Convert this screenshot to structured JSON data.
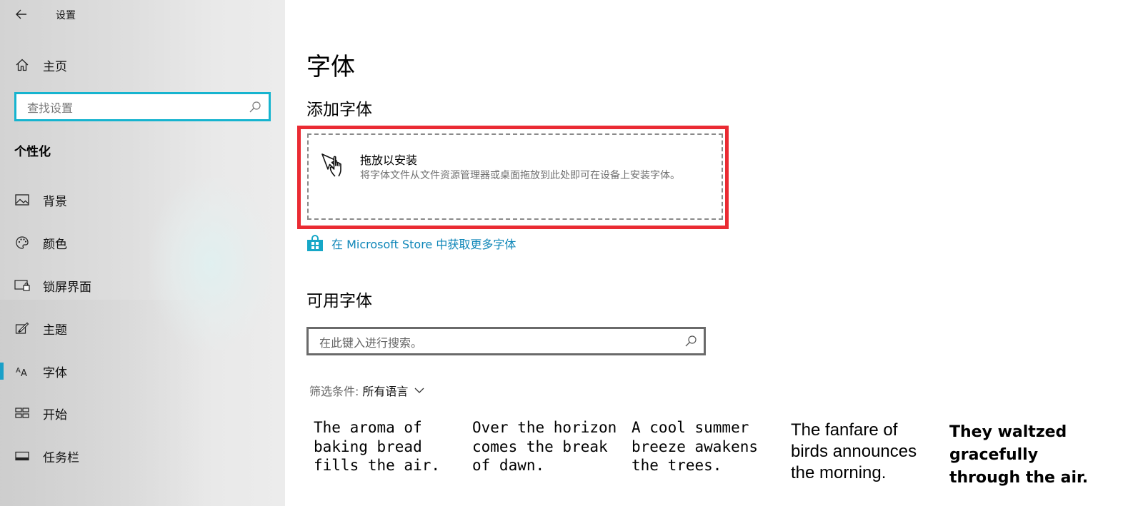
{
  "window": {
    "title": "设置"
  },
  "sidebar": {
    "home_label": "主页",
    "search_placeholder": "查找设置",
    "section": "个性化",
    "items": [
      {
        "label": "背景",
        "icon": "picture-icon"
      },
      {
        "label": "颜色",
        "icon": "palette-icon"
      },
      {
        "label": "锁屏界面",
        "icon": "lock-screen-icon"
      },
      {
        "label": "主题",
        "icon": "theme-brush-icon"
      },
      {
        "label": "字体",
        "icon": "font-icon",
        "active": true
      },
      {
        "label": "开始",
        "icon": "start-icon"
      },
      {
        "label": "任务栏",
        "icon": "taskbar-icon"
      }
    ]
  },
  "main": {
    "title": "字体",
    "add_section": {
      "heading": "添加字体",
      "drop_title": "拖放以安装",
      "drop_desc": "将字体文件从文件资源管理器或桌面拖放到此处即可在设备上安装字体。",
      "store_link": "在 Microsoft Store 中获取更多字体"
    },
    "available": {
      "heading": "可用字体",
      "search_placeholder": "在此键入进行搜索。",
      "filter_label": "筛选条件:",
      "filter_value": "所有语言"
    },
    "font_previews": [
      "The aroma of baking bread fills the air.",
      "Over the horizon comes the break of dawn.",
      "A cool summer breeze awakens the trees.",
      "The fanfare of birds announces the morning.",
      "They waltzed gracefully through the air."
    ]
  },
  "colors": {
    "accent": "#16b4cf",
    "highlight_frame": "#ea2b33",
    "link": "#0e86b8",
    "store_bag": "#16a7c7"
  }
}
